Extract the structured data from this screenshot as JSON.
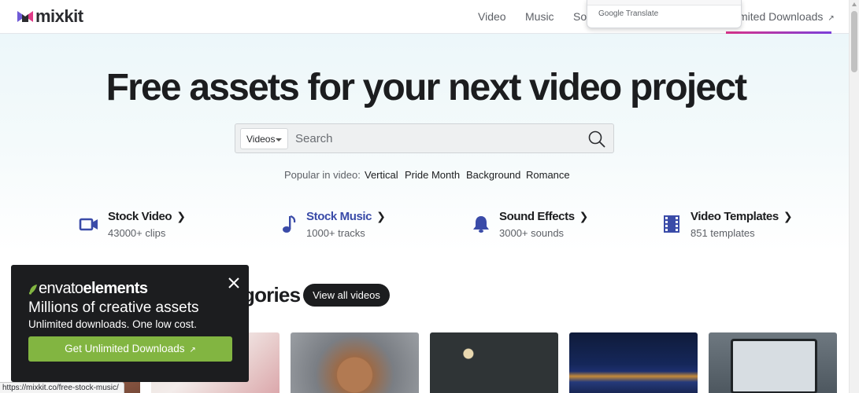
{
  "header": {
    "logo_text": "mixkit",
    "nav": {
      "video": "Video",
      "music": "Music",
      "sound": "Sou",
      "unlimited": "nlimited Downloads"
    },
    "translate_label": "Google Translate"
  },
  "hero": {
    "title": "Free assets for your next video project"
  },
  "search": {
    "category": "Videos",
    "placeholder": "Search"
  },
  "popular": {
    "label": "Popular in video:",
    "tags": [
      "Vertical",
      "Pride Month",
      "Background",
      "Romance"
    ]
  },
  "categories": [
    {
      "title": "Stock Video",
      "sub": "43000+ clips",
      "icon": "video-camera-icon"
    },
    {
      "title": "Stock Music",
      "sub": "1000+ tracks",
      "icon": "music-note-icon"
    },
    {
      "title": "Sound Effects",
      "sub": "3000+ sounds",
      "icon": "bell-icon"
    },
    {
      "title": "Video Templates",
      "sub": "851 templates",
      "icon": "film-icon"
    }
  ],
  "section": {
    "title": "gories",
    "view_all": "View all videos"
  },
  "promo": {
    "logo_light": "envato",
    "logo_bold": "elements",
    "headline": "Millions of creative assets",
    "sub": "Unlimited downloads. One low cost.",
    "cta": "Get Unlimited Downloads"
  },
  "status_url": "https://mixkit.co/free-stock-music/",
  "colors": {
    "accent_gradient_start": "#d8338a",
    "accent_gradient_end": "#7b3fd9",
    "icon_blue": "#3a4ba8",
    "promo_green": "#82b541",
    "promo_bg": "#1c1d1f"
  }
}
